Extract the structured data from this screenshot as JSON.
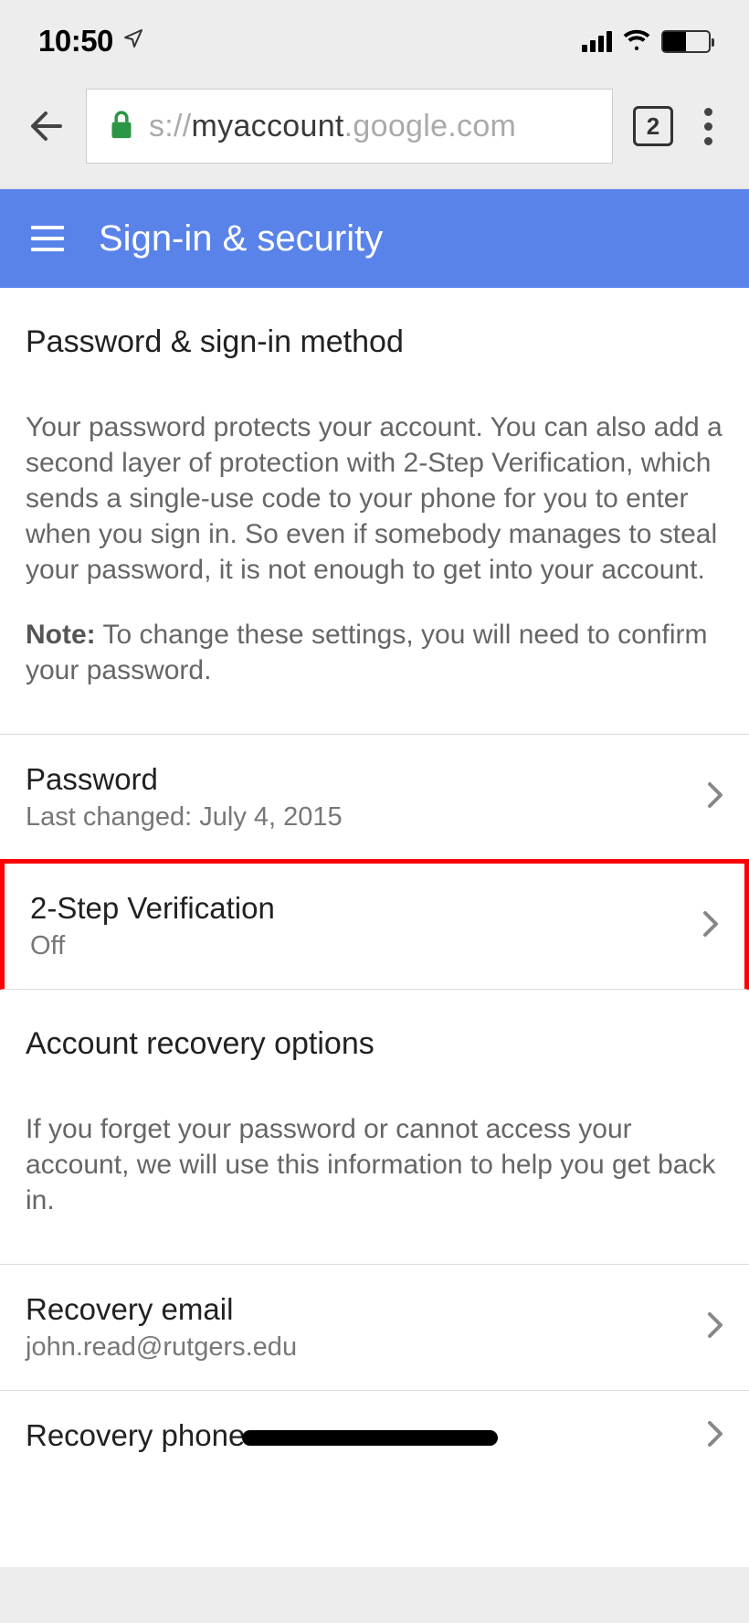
{
  "status": {
    "time": "10:50",
    "tabs_count": "2"
  },
  "address_bar": {
    "prefix": "s://",
    "domain_main": "myaccount",
    "domain_tail": ".google.com"
  },
  "header": {
    "title": "Sign-in & security"
  },
  "section_password": {
    "title": "Password & sign-in method",
    "description": "Your password protects your account. You can also add a second layer of protection with 2-Step Verification, which sends a single-use code to your phone for you to enter when you sign in. So even if somebody manages to steal your password, it is not enough to get into your account.",
    "note_label": "Note:",
    "note_text": " To change these settings, you will need to confirm your password."
  },
  "items_password": [
    {
      "label": "Password",
      "sub": "Last changed: July 4, 2015"
    },
    {
      "label": "2-Step Verification",
      "sub": "Off"
    }
  ],
  "section_recovery": {
    "title": "Account recovery options",
    "description": "If you forget your password or cannot access your account, we will use this information to help you get back in."
  },
  "items_recovery": [
    {
      "label": "Recovery email",
      "sub": "john.read@rutgers.edu"
    },
    {
      "label": "Recovery phone",
      "sub": ""
    }
  ]
}
